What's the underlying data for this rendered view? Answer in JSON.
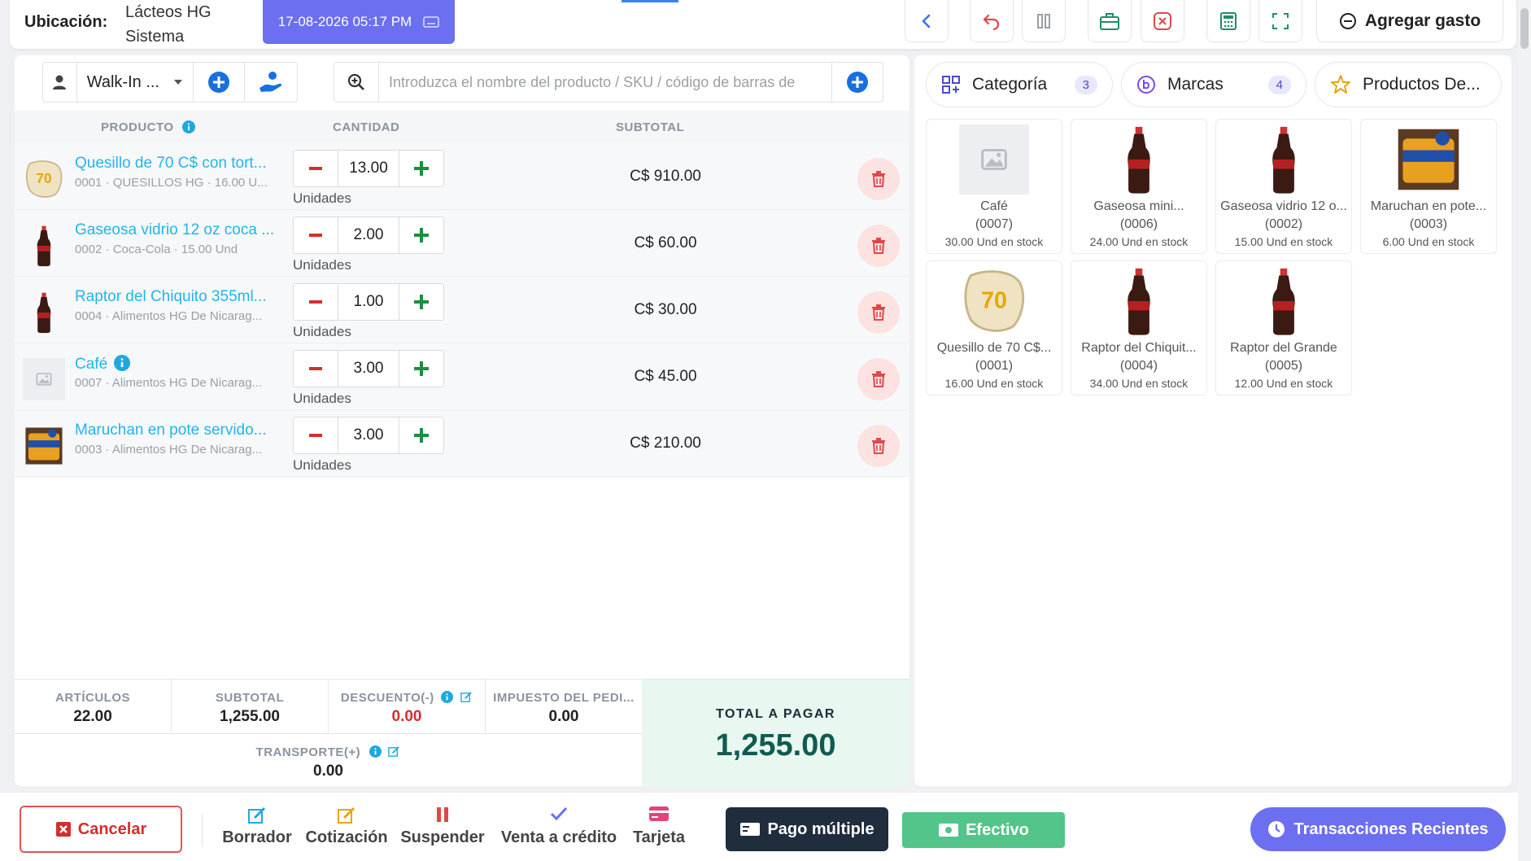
{
  "colors": {
    "accent": "#6b6ff0",
    "link": "#21b5ea",
    "danger": "#d32f2f",
    "success": "#1e8e3e",
    "total": "#0f5b50",
    "cash": "#53c58a",
    "dark": "#1f2d3d"
  },
  "header": {
    "location_label": "Ubicación:",
    "location_line1": "Lácteos HG",
    "location_line2": "Sistema",
    "datetime": "17-08-2026 05:17 PM",
    "add_expense": "Agregar gasto"
  },
  "customer": {
    "selected": "Walk-In ..."
  },
  "search": {
    "placeholder": "Introduzca el nombre del producto / SKU / código de barras de"
  },
  "table": {
    "headers": {
      "product": "PRODUCTO",
      "quantity": "CANTIDAD",
      "subtotal": "SUBTOTAL"
    },
    "rows": [
      {
        "name": "Quesillo de 70 C$ con tort...",
        "sub": "0001 · QUESILLOS HG  ·  16.00 U...",
        "qty": "13.00",
        "unit": "Unidades",
        "subtotal": "C$ 910.00",
        "thumb": "quesillo"
      },
      {
        "name": "Gaseosa vidrio 12 oz coca ...",
        "sub": "0002 · Coca-Cola  ·  15.00 Und",
        "qty": "2.00",
        "unit": "Unidades",
        "subtotal": "C$ 60.00",
        "thumb": "bottle"
      },
      {
        "name": "Raptor del Chiquito 355ml...",
        "sub": "0004 · Alimentos HG De Nicarag...",
        "qty": "1.00",
        "unit": "Unidades",
        "subtotal": "C$ 30.00",
        "thumb": "bottle"
      },
      {
        "name": "Café",
        "sub": "0007 · Alimentos HG De Nicarag...",
        "qty": "3.00",
        "unit": "Unidades",
        "subtotal": "C$ 45.00",
        "thumb": "placeholder"
      },
      {
        "name": "Maruchan en pote servido...",
        "sub": "0003 · Alimentos HG De Nicarag...",
        "qty": "3.00",
        "unit": "Unidades",
        "subtotal": "C$ 210.00",
        "thumb": "maruchan"
      }
    ]
  },
  "totals": {
    "items_label": "ARTÍCULOS",
    "items": "22.00",
    "subtotal_label": "SUBTOTAL",
    "subtotal": "1,255.00",
    "discount_label": "DESCUENTO(-)",
    "discount": "0.00",
    "tax_label": "IMPUESTO DEL PEDI...",
    "tax": "0.00",
    "shipping_label": "TRANSPORTE(+)",
    "shipping": "0.00",
    "total_label": "TOTAL A PAGAR",
    "total": "1,255.00"
  },
  "filters": [
    {
      "label": "Categoría",
      "count": "3",
      "icon": "grid-icon"
    },
    {
      "label": "Marcas",
      "count": "4",
      "icon": "brand-icon"
    },
    {
      "label": "Productos De...",
      "count": "",
      "icon": "star-icon"
    }
  ],
  "products": [
    {
      "name": "Café",
      "code": "(0007)",
      "stock": "30.00 Und en stock",
      "thumb": "placeholder"
    },
    {
      "name": "Gaseosa mini...",
      "code": "(0006)",
      "stock": "24.00 Und en stock",
      "thumb": "bottle"
    },
    {
      "name": "Gaseosa vidrio 12 o...",
      "code": "(0002)",
      "stock": "15.00 Und en stock",
      "thumb": "bottle"
    },
    {
      "name": "Maruchan en pote...",
      "code": "(0003)",
      "stock": "6.00 Und en stock",
      "thumb": "maruchan"
    },
    {
      "name": "Quesillo de 70 C$...",
      "code": "(0001)",
      "stock": "16.00 Und en stock",
      "thumb": "quesillo"
    },
    {
      "name": "Raptor del Chiquit...",
      "code": "(0004)",
      "stock": "34.00 Und en stock",
      "thumb": "bottle"
    },
    {
      "name": "Raptor del Grande",
      "code": "(0005)",
      "stock": "12.00 Und en stock",
      "thumb": "bottle"
    }
  ],
  "footer": {
    "cancel": "Cancelar",
    "draft": "Borrador",
    "quote": "Cotización",
    "suspend": "Suspender",
    "credit": "Venta a crédito",
    "card": "Tarjeta",
    "multi_pay": "Pago múltiple",
    "cash": "Efectivo",
    "recent": "Transacciones Recientes"
  }
}
